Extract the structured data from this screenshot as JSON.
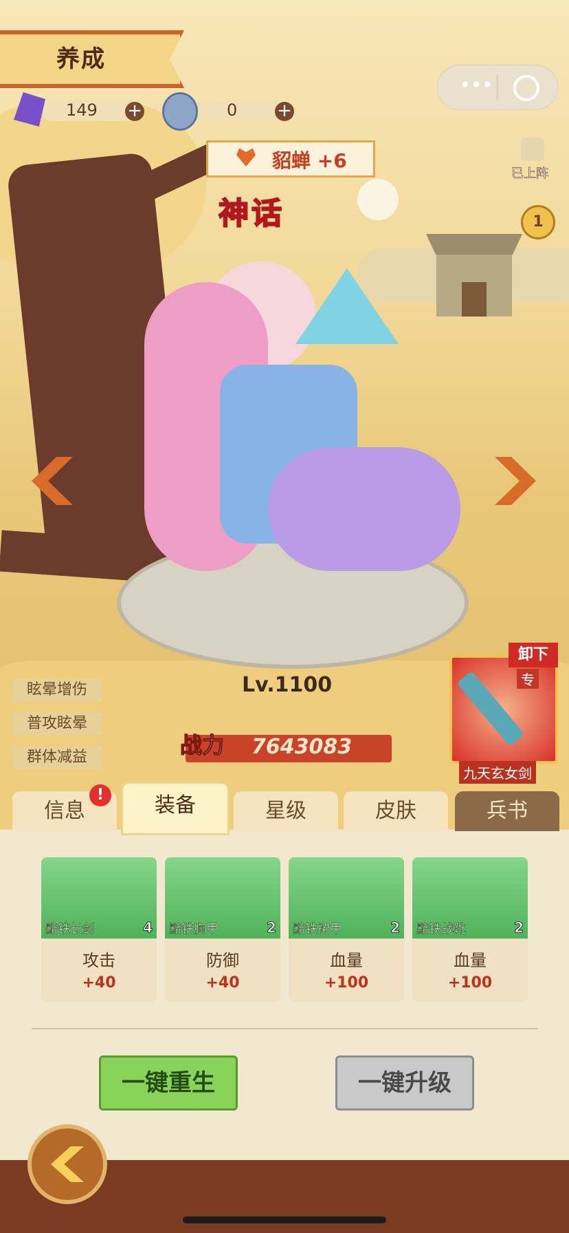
{
  "title": "养成",
  "currency": [
    {
      "icon": "purple-crystal-icon",
      "value": "149"
    },
    {
      "icon": "silver-token-icon",
      "value": "0"
    }
  ],
  "hero": {
    "bond_label": "貂蝉 +6",
    "rarity": "神话",
    "level": "Lv.1100",
    "power_label": "战力",
    "power_value": "7643083",
    "deployed_label": "已上阵",
    "rank": "1"
  },
  "side_tags": [
    "眩晕增伤",
    "普攻眩晕",
    "群体减益"
  ],
  "weapon": {
    "unequip_label": "卸下",
    "exclusive_mark": "专",
    "name": "九天玄女剑"
  },
  "tabs": [
    "信息",
    "装备",
    "星级",
    "皮肤",
    "兵书"
  ],
  "equipment": [
    {
      "name": "黯铁长剑",
      "count": "4",
      "stat": "攻击",
      "value": "+40",
      "icon": "sword-icon"
    },
    {
      "name": "黯铁胸甲",
      "count": "2",
      "stat": "防御",
      "value": "+40",
      "icon": "chest-armor-icon"
    },
    {
      "name": "黯铁裙甲",
      "count": "2",
      "stat": "血量",
      "value": "+100",
      "icon": "skirt-armor-icon"
    },
    {
      "name": "黯铁战靴",
      "count": "2",
      "stat": "血量",
      "value": "+100",
      "icon": "boots-icon"
    }
  ],
  "buttons": {
    "rebirth": "一键重生",
    "upgrade": "一键升级"
  },
  "colors": {
    "accent": "#c8642c",
    "power": "#c0301c",
    "green_button": "#8ad35b",
    "gray_button": "#c9c9c9"
  }
}
